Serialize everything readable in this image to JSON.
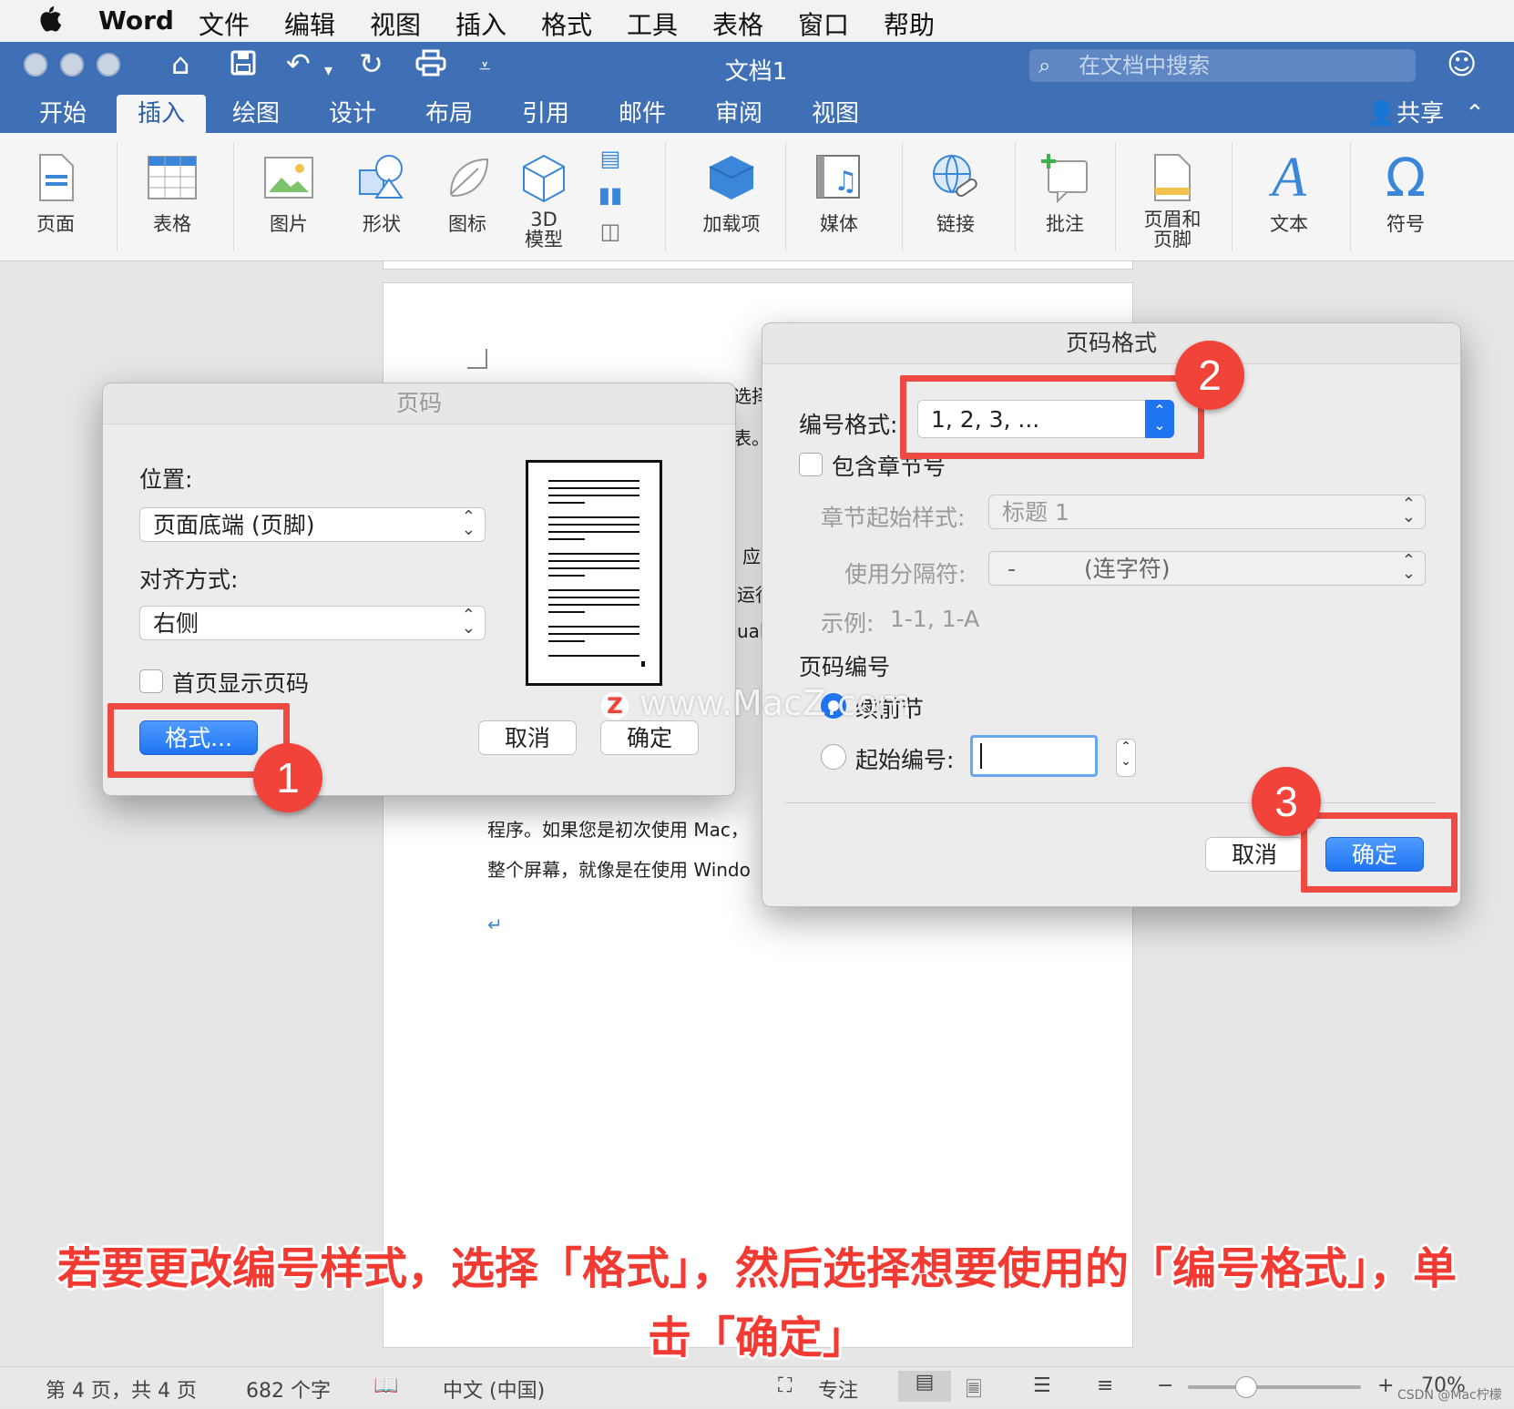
{
  "menubar": {
    "apple": "",
    "app_name": "Word",
    "items": [
      "文件",
      "编辑",
      "视图",
      "插入",
      "格式",
      "工具",
      "表格",
      "窗口",
      "帮助"
    ]
  },
  "titlebar": {
    "document_title": "文档1",
    "search_placeholder": "在文档中搜索"
  },
  "tabs": [
    "开始",
    "插入",
    "绘图",
    "设计",
    "布局",
    "引用",
    "邮件",
    "审阅",
    "视图"
  ],
  "active_tab": "插入",
  "share_label": "共享",
  "ribbon": {
    "page": "页面",
    "table": "表格",
    "picture": "图片",
    "shape": "形状",
    "icon": "图标",
    "model3d_line1": "3D",
    "model3d_line2": "模型",
    "addins": "加载项",
    "media": "媒体",
    "link": "链接",
    "comment": "批注",
    "header_line1": "页眉和",
    "header_line2": "页脚",
    "text": "文本",
    "symbol": "符号"
  },
  "document": {
    "frag1": "选择",
    "frag2": "表。",
    "frag3": "应",
    "frag4": "运行",
    "frag5": "ual",
    "line_a": "程序。如果您是初次使用  Mac，",
    "line_b": "整个屏幕，就像是在使用  Windo",
    "return_mark": "↵"
  },
  "page_number_dialog": {
    "title": "页码",
    "position_label": "位置:",
    "position_value": "页面底端 (页脚)",
    "alignment_label": "对齐方式:",
    "alignment_value": "右侧",
    "first_page_label": "首页显示页码",
    "format_button": "格式...",
    "cancel_button": "取消",
    "ok_button": "确定"
  },
  "format_dialog": {
    "title": "页码格式",
    "number_format_label": "编号格式:",
    "number_format_value": "1, 2, 3, ...",
    "include_chapter_label": "包含章节号",
    "chapter_style_label": "章节起始样式:",
    "chapter_style_value": "标题 1",
    "separator_label": "使用分隔符:",
    "separator_value_char": "-",
    "separator_value_name": "(连字符)",
    "example_label": "示例:",
    "example_value": "1-1, 1-A",
    "numbering_section": "页码编号",
    "continue_label": "续前节",
    "start_at_label": "起始编号:",
    "start_at_value": "",
    "cancel_button": "取消",
    "ok_button": "确定"
  },
  "callouts": [
    "1",
    "2",
    "3"
  ],
  "watermark": "www.MacZ.com",
  "caption_line1": "若要更改编号样式，选择「格式」，然后选择想要使用的「编号格式」，单",
  "caption_line2": "击「确定」",
  "statusbar": {
    "page_info": "第 4 页，共 4 页",
    "word_count": "682 个字",
    "language": "中文 (中国)",
    "focus": "专注",
    "zoom": "70%",
    "credit": "CSDN @Mac柠檬"
  },
  "colors": {
    "titlebar": "#3f6fb5",
    "accent_blue": "#1f74f2",
    "callout_red": "#ef4a42"
  }
}
